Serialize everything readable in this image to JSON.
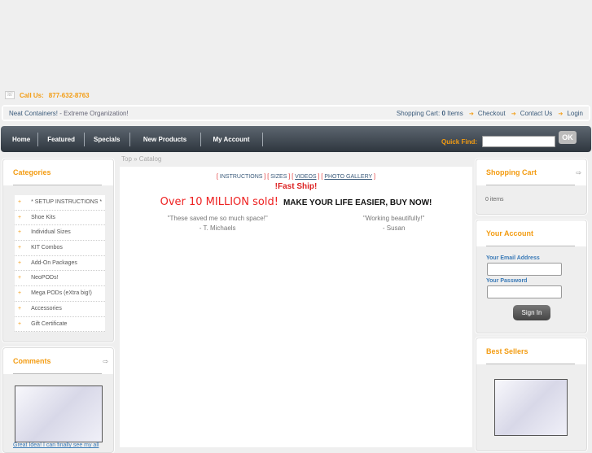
{
  "header": {
    "call_label": "Call Us:",
    "phone": "877-632-8763",
    "site_name": "Neat Containers!",
    "tagline": " - Extreme Organization!",
    "cart_label": "Shopping Cart:",
    "cart_count": "0",
    "cart_items": "Items",
    "checkout": "Checkout",
    "contact": "Contact Us",
    "login": "Login"
  },
  "nav": {
    "items": [
      "Home",
      "Featured",
      "Specials",
      "New Products",
      "My Account"
    ],
    "quick_find": "Quick Find:",
    "ok": "OK"
  },
  "breadcrumb": "Top » Catalog",
  "categories": {
    "title": "Categories",
    "items": [
      "* SETUP INSTRUCTIONS *",
      "Shoe Kits",
      "Individual Sizes",
      "KIT Combos",
      "Add-On Packages",
      "NeoPODs!",
      "Mega PODs (eXtra big!)",
      "Accessories",
      "Gift Certificate"
    ]
  },
  "comments": {
    "title": "Comments",
    "caption": "Great Idea! I can finally see my all"
  },
  "main": {
    "links": [
      "INSTRUCTIONS",
      "SIZES",
      "VIDEOS",
      "PHOTO GALLERY"
    ],
    "fast_ship": "!Fast Ship!",
    "sold": "Over 10 MILLION sold!",
    "cta": "MAKE YOUR LIFE EASIER, BUY NOW!",
    "quotes": [
      {
        "text": "\"These saved me so much space!\"",
        "author": "- T. Michaels"
      },
      {
        "text": "\"Working beautifully!\"",
        "author": "- Susan"
      }
    ]
  },
  "cart_box": {
    "title": "Shopping Cart",
    "content": "0 items"
  },
  "account": {
    "title": "Your Account",
    "email_label": "Your Email Address",
    "password_label": "Your Password",
    "sign_in": "Sign In"
  },
  "best_sellers": {
    "title": "Best Sellers"
  }
}
